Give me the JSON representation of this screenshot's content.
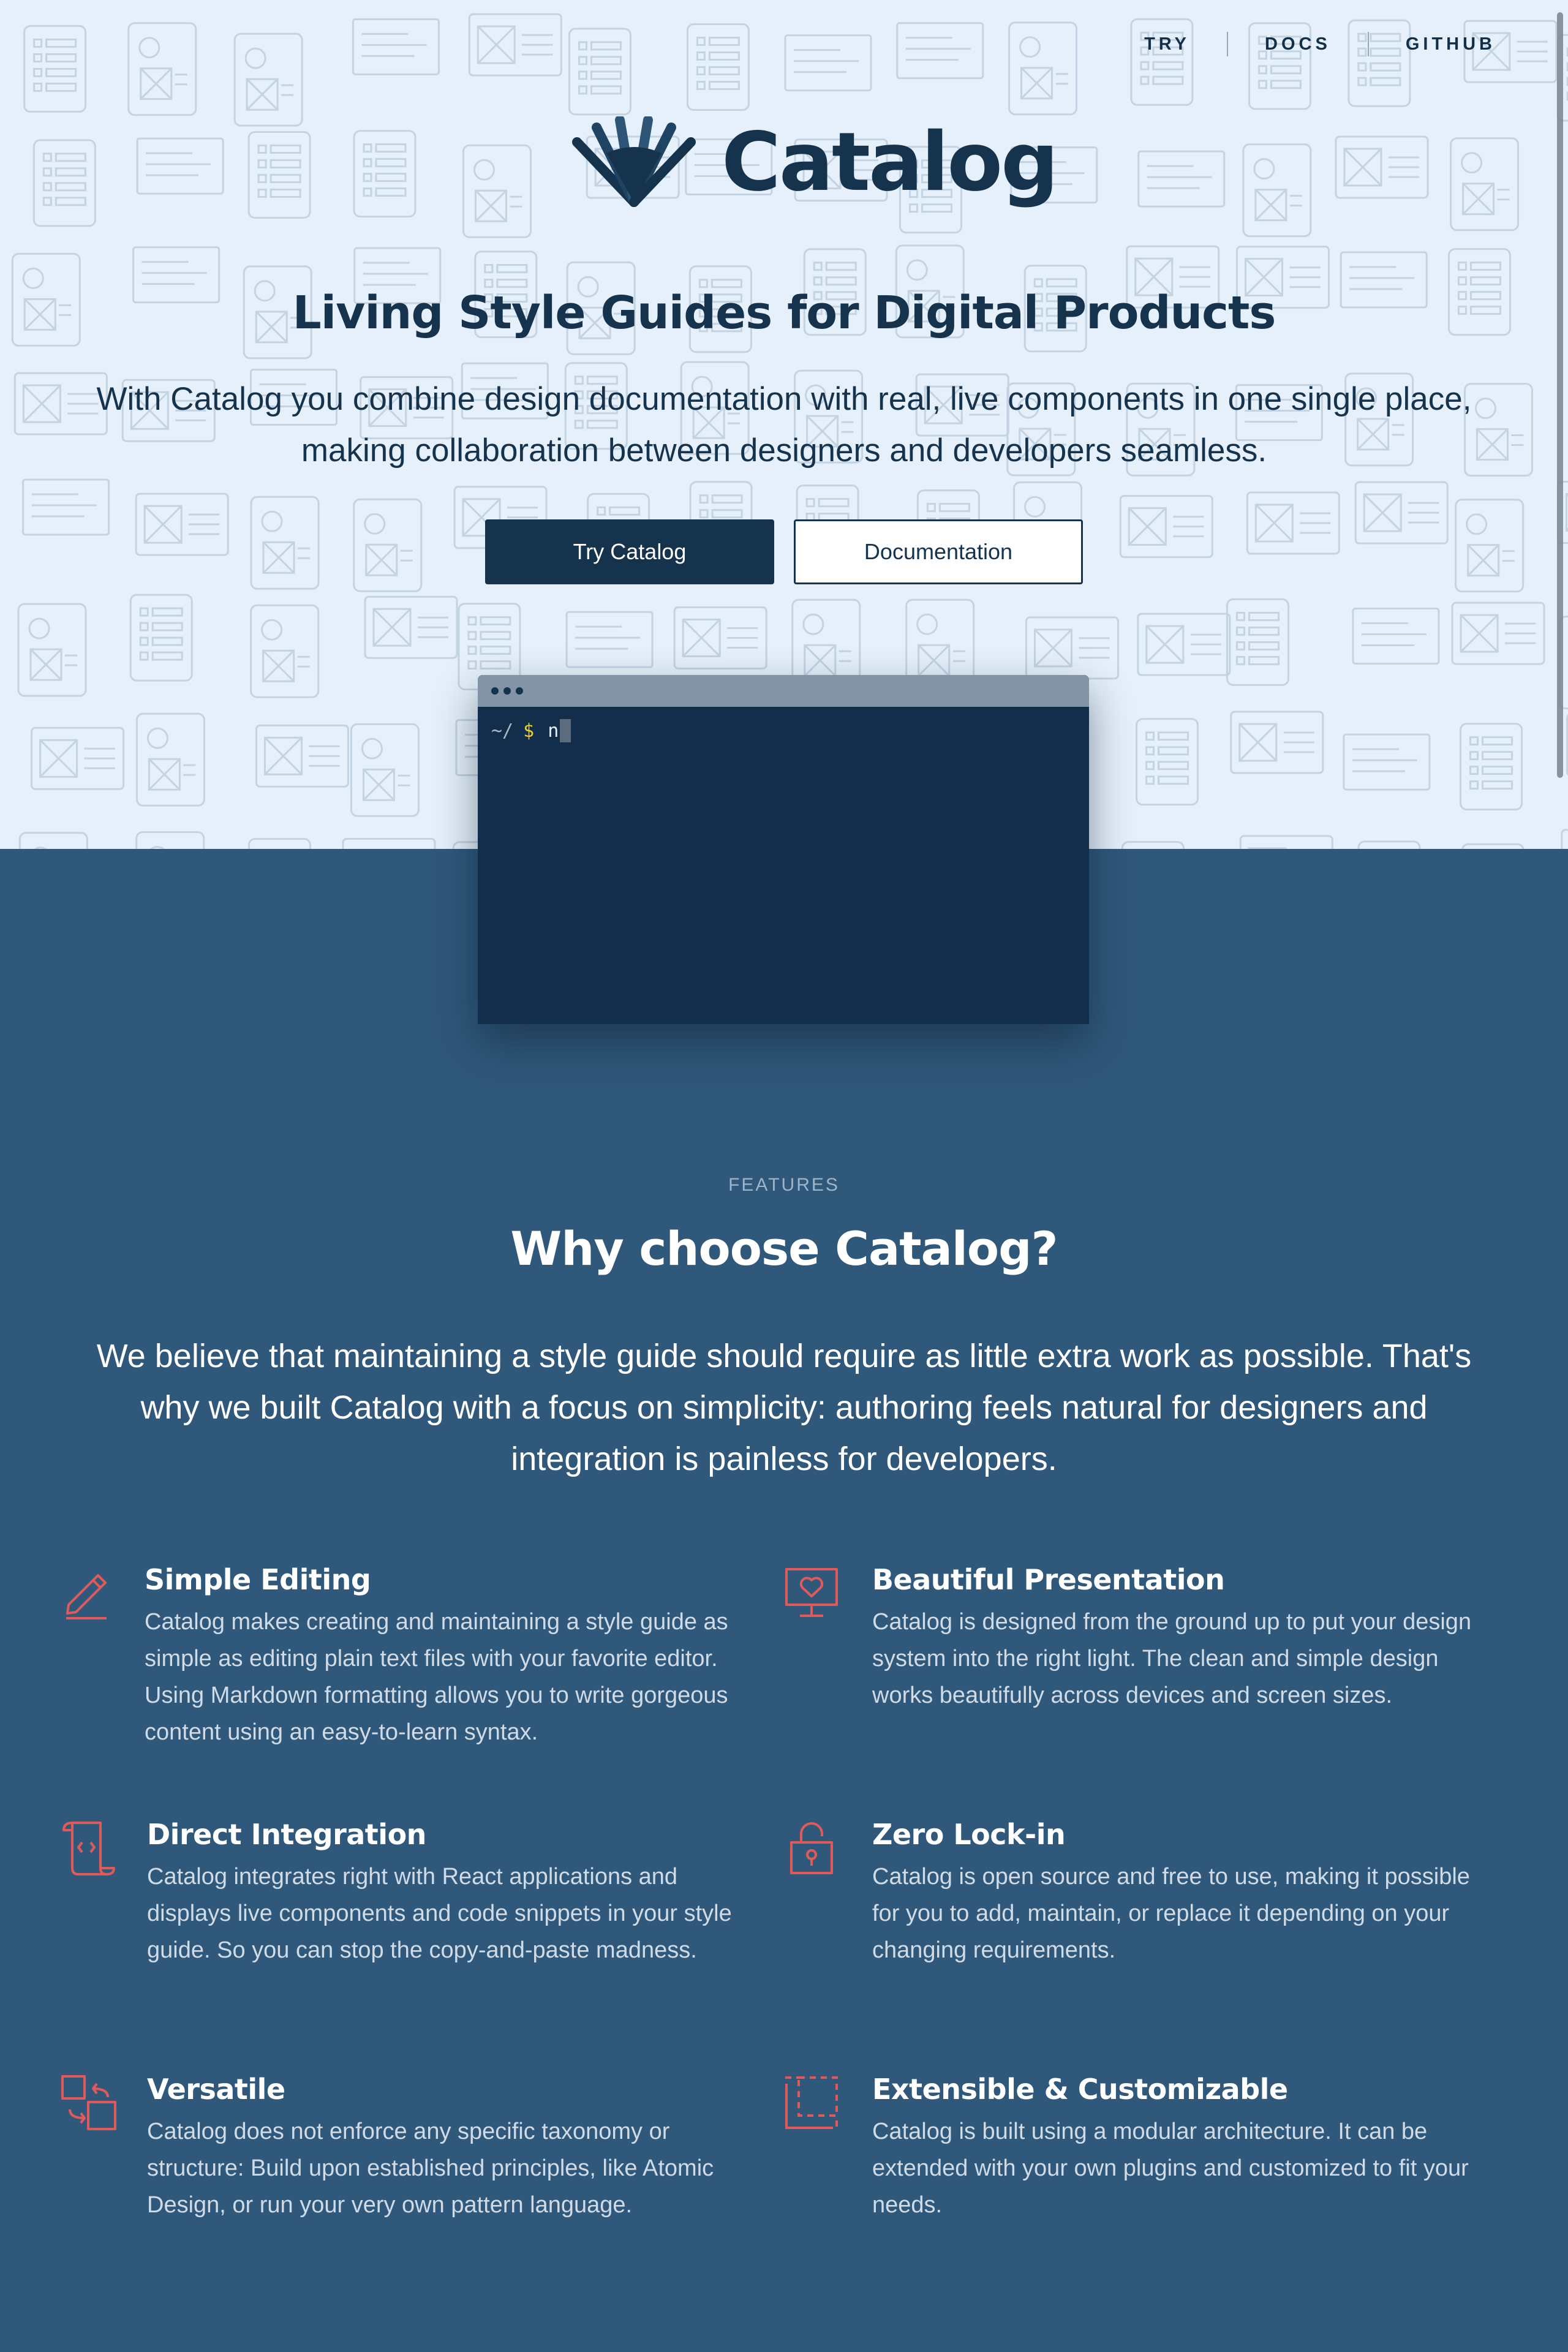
{
  "nav": {
    "links": [
      {
        "label": "TRY"
      },
      {
        "label": "DOCS"
      },
      {
        "label": "GITHUB"
      }
    ]
  },
  "logo": {
    "text": "Catalog"
  },
  "hero": {
    "title": "Living Style Guides for Digital Products",
    "subtitle": "With Catalog you combine design documentation with real, live components in one single place, making collaboration between designers and developers seamless.",
    "primary_button": "Try Catalog",
    "secondary_button": "Documentation"
  },
  "terminal": {
    "path": "~/",
    "prompt": "$",
    "input": "n"
  },
  "features": {
    "label": "FEATURES",
    "title": "Why choose Catalog?",
    "intro": "We believe that maintaining a style guide should require as little extra work as possible. That's why we built Catalog with a focus on simplicity: authoring feels natural for designers and integration is painless for developers.",
    "items": [
      {
        "icon": "pencil-icon",
        "title": "Simple Editing",
        "text": "Catalog makes creating and maintaining a style guide as simple as editing plain text files with your favorite editor. Using Markdown formatting allows you to write gorgeous content using an easy-to-learn syntax."
      },
      {
        "icon": "heart-monitor-icon",
        "title": "Beautiful Presentation",
        "text": "Catalog is designed from the ground up to put your design system into the right light. The clean and simple design works beautifully across devices and screen sizes."
      },
      {
        "icon": "code-scroll-icon",
        "title": "Direct Integration",
        "text": "Catalog integrates right with React applications and displays live components and code snippets in your style guide. So you can stop the copy-and-paste madness."
      },
      {
        "icon": "unlocked-padlock-icon",
        "title": "Zero Lock-in",
        "text": "Catalog is open source and free to use, making it possible for you to add, maintain, or replace it depending on your changing requirements."
      },
      {
        "icon": "swap-icon",
        "title": "Versatile",
        "text": "Catalog does not enforce any specific taxonomy or structure: Build upon established principles, like Atomic Design, or run your very own pattern language."
      },
      {
        "icon": "expand-corners-icon",
        "title": "Extensible & Customizable",
        "text": "Catalog is built using a modular architecture. It can be extended with your own plugins and customized to fit your needs."
      }
    ]
  },
  "colors": {
    "accent": "#e05a5a",
    "navy": "#16334d",
    "section_bg": "#30587a",
    "hero_bg": "#e5f0fa"
  }
}
